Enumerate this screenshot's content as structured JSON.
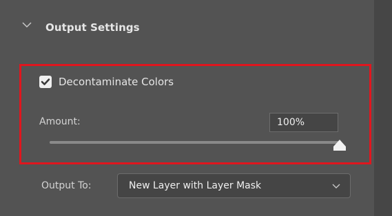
{
  "section": {
    "title": "Output Settings",
    "expanded": true
  },
  "decontaminate": {
    "label": "Decontaminate Colors",
    "checked": true
  },
  "amount": {
    "label": "Amount:",
    "value": "100%",
    "slider_level": 1.0
  },
  "output": {
    "label": "Output To:",
    "selected": "New Layer with Layer Mask"
  },
  "colors": {
    "highlight": "#e0161e",
    "panel_bg": "#535353"
  }
}
